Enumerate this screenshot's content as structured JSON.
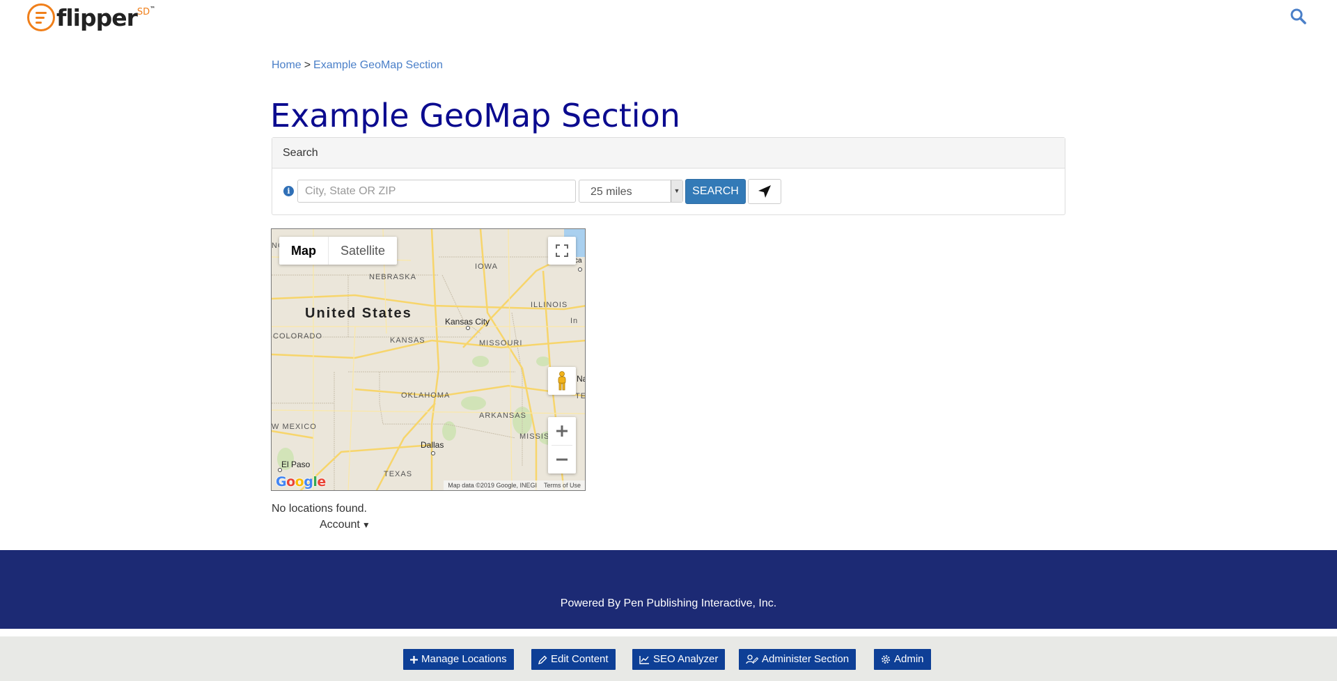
{
  "header": {
    "logo_text": "flipper",
    "logo_sup": "SD",
    "logo_tm": "™",
    "search_icon": "search-icon"
  },
  "breadcrumb": {
    "home": "Home",
    "separator": ">",
    "current": "Example GeoMap Section"
  },
  "page": {
    "title": "Example GeoMap Section"
  },
  "search": {
    "panel_title": "Search",
    "info_icon": "info-icon",
    "info_glyph": "i",
    "placeholder": "City, State OR ZIP",
    "value": "",
    "distance": "25 miles",
    "search_button": "SEARCH",
    "locate_icon": "location-arrow-icon"
  },
  "map": {
    "type_map": "Map",
    "type_satellite": "Satellite",
    "labels": {
      "country": "United States",
      "nebraska": "NEBRASKA",
      "iowa": "IOWA",
      "illinois": "ILLINOIS",
      "kansas": "KANSAS",
      "missouri": "MISSOURI",
      "colorado": "COLORADO",
      "oklahoma": "OKLAHOMA",
      "arkansas": "ARKANSAS",
      "new_mexico": "W MEXICO",
      "texas": "TEXAS",
      "mississippi": "MISSIS",
      "tennessee": "TEN",
      "kansas_city": "Kansas City",
      "dallas": "Dallas",
      "el_paso": "El Paso",
      "chicago": "Chica",
      "indiana": "In",
      "nashville": "Na",
      "nebraska_edge": "NC"
    },
    "google": "Google",
    "attribution": "Map data ©2019 Google, INEGI",
    "terms": "Terms of Use"
  },
  "results": {
    "empty_message": "No locations found.",
    "account": "Account"
  },
  "footer": {
    "powered_by": "Powered By Pen Publishing Interactive, Inc."
  },
  "admin_bar": {
    "manage_locations": "Manage Locations",
    "edit_content": "Edit Content",
    "seo_analyzer": "SEO Analyzer",
    "administer_section": "Administer Section",
    "admin": "Admin"
  },
  "colors": {
    "brand_orange": "#f07f1a",
    "link_blue": "#4a7fc8",
    "title_navy": "#0b0b8f",
    "button_blue": "#337ab7",
    "footer_navy": "#1c2a74",
    "admin_button": "#0e3f96"
  }
}
